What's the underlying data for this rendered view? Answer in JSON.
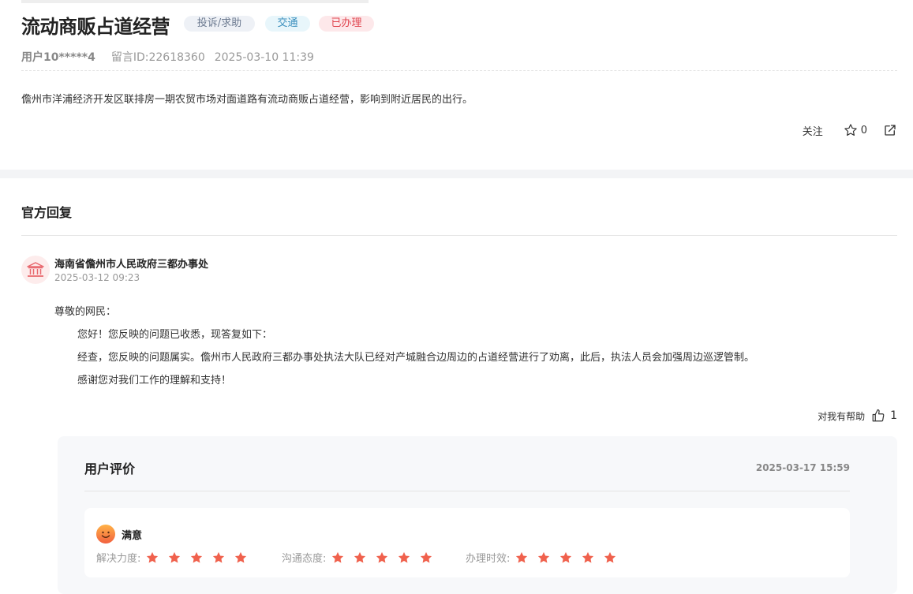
{
  "post": {
    "title": "流动商贩占道经营",
    "tags": {
      "category": "投诉/求助",
      "field": "交通",
      "status": "已办理"
    },
    "user": "用户10*****4",
    "message_id": "留言ID:22618360",
    "datetime": "2025-03-10 11:39",
    "content": "儋州市洋浦经济开发区联排房一期农贸市场对面道路有流动商贩占道经营，影响到附近居民的出行。"
  },
  "actions": {
    "follow": "关注",
    "star_count": "0"
  },
  "reply_section": {
    "title": "官方回复",
    "department": "海南省儋州市人民政府三都办事处",
    "time": "2025-03-12 09:23",
    "greeting": "尊敬的网民：",
    "paragraphs": [
      "您好！您反映的问题已收悉，现答复如下：",
      "经查，您反映的问题属实。儋州市人民政府三都办事处执法大队已经对产城融合边周边的占道经营进行了劝离，此后，执法人员会加强周边巡逻管制。",
      "感谢您对我们工作的理解和支持！"
    ],
    "helpful_label": "对我有帮助",
    "helpful_count": "1"
  },
  "evaluation": {
    "title": "用户评价",
    "time": "2025-03-17 15:59",
    "overall": "满意",
    "ratings": [
      {
        "label": "解决力度:",
        "stars": 5
      },
      {
        "label": "沟通态度:",
        "stars": 5
      },
      {
        "label": "办理时效:",
        "stars": 5
      }
    ]
  },
  "colors": {
    "star": "#f0614d",
    "status_tag": "#e0454f",
    "accent_blue": "#3a8fbd"
  }
}
